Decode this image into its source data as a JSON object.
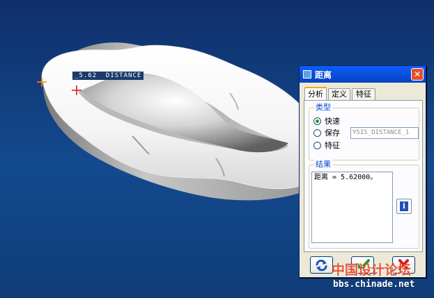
{
  "viewport": {
    "dimension_label": "_5.62  DISTANCE",
    "background_top": "#0f2f6a",
    "background_bottom": "#134a8e"
  },
  "dialog": {
    "title": "距离",
    "close_label": "✕",
    "tabs": [
      {
        "label": "分析",
        "active": true
      },
      {
        "label": "定义",
        "active": false
      },
      {
        "label": "特征",
        "active": false
      }
    ],
    "type_group": {
      "title": "类型",
      "options": [
        {
          "label": "快速",
          "checked": true
        },
        {
          "label": "保存",
          "checked": false
        },
        {
          "label": "特征",
          "checked": false
        }
      ],
      "name_value": "YSIS_DISTANCE_1"
    },
    "result_group": {
      "title": "结果",
      "text": "距离 = 5.62000。"
    },
    "info_label": "i",
    "buttons": {
      "repeat_icon": "repeat-icon",
      "ok_icon": "check-icon",
      "cancel_icon": "cross-icon"
    }
  },
  "watermark": {
    "chinese": "中国设计论坛",
    "url": "bbs.chinade.net"
  },
  "colors": {
    "titlebar": "#0a4fdc",
    "accent_tab": "#f9a800",
    "group_title": "#0046d5",
    "ok_green": "#1e9e2e",
    "cancel_red": "#d41d16"
  }
}
